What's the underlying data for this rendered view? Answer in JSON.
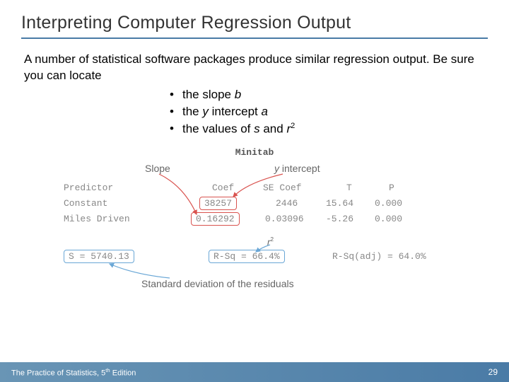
{
  "title": "Interpreting Computer Regression Output",
  "intro": "A number of statistical software packages produce similar regression output. Be sure you can locate",
  "bullets": {
    "b1_pre": "the slope ",
    "b1_var": "b",
    "b2_pre": "the ",
    "b2_var": "y",
    "b2_post": " intercept ",
    "b2_var2": "a",
    "b3_pre": "the values of ",
    "b3_var1": "s",
    "b3_mid": " and ",
    "b3_var2": "r",
    "b3_sup": "2"
  },
  "diagram": {
    "software": "Minitab",
    "ann_slope": "Slope",
    "ann_yint_y": "y",
    "ann_yint_rest": " intercept",
    "ann_r2_r": "r",
    "ann_r2_sup": "2",
    "ann_sd": "Standard deviation of the residuals",
    "headers": {
      "predictor": "Predictor",
      "coef": "Coef",
      "secoef": "SE Coef",
      "t": "T",
      "p": "P"
    },
    "rows": {
      "constant": {
        "label": "Constant",
        "coef": "38257",
        "se": "2446",
        "t": "15.64",
        "p": "0.000"
      },
      "miles": {
        "label": "Miles Driven",
        "coef": "0.16292",
        "se": "0.03096",
        "t": "-5.26",
        "p": "0.000"
      }
    },
    "s_label": "S = 5740.13",
    "rsq": "R-Sq = 66.4%",
    "rsqadj": "R-Sq(adj) = 64.0%"
  },
  "footer": {
    "book_pre": "The Practice of Statistics, 5",
    "book_sup": "th",
    "book_post": " Edition",
    "page": "29"
  }
}
